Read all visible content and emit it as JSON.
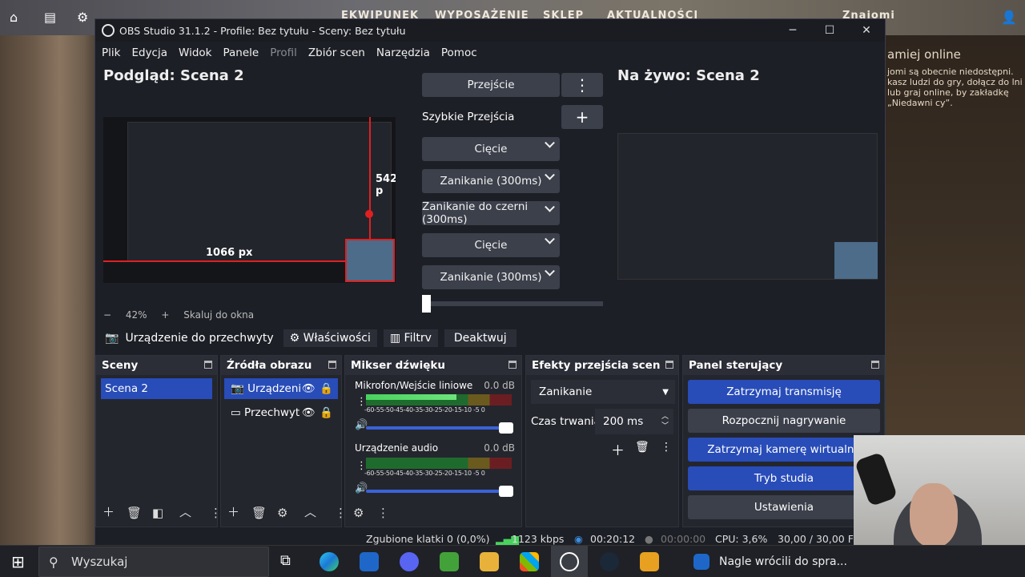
{
  "game": {
    "nav": [
      "EKWIPUNEK",
      "WYPOSAŻENIE",
      "SKLEP",
      "AKTUALNOŚCI"
    ],
    "user": "Znajomi",
    "friends_title": "amiej online",
    "friends_text": "jomi są obecnie niedostępni. kasz ludzi do gry, dołącz do lni lub graj online, by zakładkę „Niedawni cy”."
  },
  "window": {
    "title": "OBS Studio 31.1.2 - Profile: Bez tytułu - Sceny: Bez tytułu"
  },
  "menu": [
    "Plik",
    "Edycja",
    "Widok",
    "Panele",
    "Profil",
    "Zbiór scen",
    "Narzędzia",
    "Pomoc"
  ],
  "preview": {
    "title": "Podgląd: Scena 2",
    "zoom": "42%",
    "fit": "Skaluj do okna",
    "dim_h": "542 p",
    "dim_w": "1066 px"
  },
  "live": {
    "title": "Na żywo: Scena 2"
  },
  "transitions": {
    "main": "Przejście",
    "quick": "Szybkie Przejścia",
    "items": [
      "Cięcie",
      "Zanikanie (300ms)",
      "Zanikanie do czerni (300ms)",
      "Cięcie",
      "Zanikanie (300ms)"
    ]
  },
  "source_bar": {
    "device": "Urządzenie do przechwyty",
    "properties": "Właściwości",
    "filters": "Filtrv",
    "deactivate": "Deaktwuj"
  },
  "docks": {
    "scenes": {
      "title": "Sceny",
      "items": [
        "Scena 2"
      ]
    },
    "sources": {
      "title": "Źródła obrazu",
      "items": [
        "Urządzeni",
        "Przechwyt"
      ]
    },
    "mixer": {
      "title": "Mikser dźwięku",
      "channels": [
        {
          "name": "Mikrofon/Wejście liniowe",
          "db": "0.0 dB",
          "level": 0.62
        },
        {
          "name": "Urządzenie audio",
          "db": "0.0 dB",
          "level": 0
        }
      ],
      "ticks": "-60-55-50-45-40-35-30-25-20-15-10 -5 0"
    },
    "trans_fx": {
      "title": "Efekty przejścia scen",
      "type": "Zanikanie",
      "duration_label": "Czas trwania",
      "duration": "200 ms"
    },
    "controls": {
      "title": "Panel sterujący",
      "buttons": [
        "Zatrzymaj transmisję",
        "Rozpocznij nagrywanie",
        "Zatrzymaj kamerę wirtualną",
        "Tryb studia",
        "Ustawienia"
      ]
    }
  },
  "status": {
    "dropped": "Zgubione klatki 0 (0,0%)",
    "bitrate": "1123 kbps",
    "stream_time": "00:20:12",
    "rec_time": "00:00:00",
    "cpu": "CPU: 3,6%",
    "fps": "30,00 / 30,00 FP"
  },
  "taskbar": {
    "search": "Wyszukaj",
    "app_label": "Nagle wrócili do spra..."
  },
  "colors": {
    "accent": "#284cb8",
    "obs_bg": "#1d1f26",
    "dock": "#24262e"
  }
}
